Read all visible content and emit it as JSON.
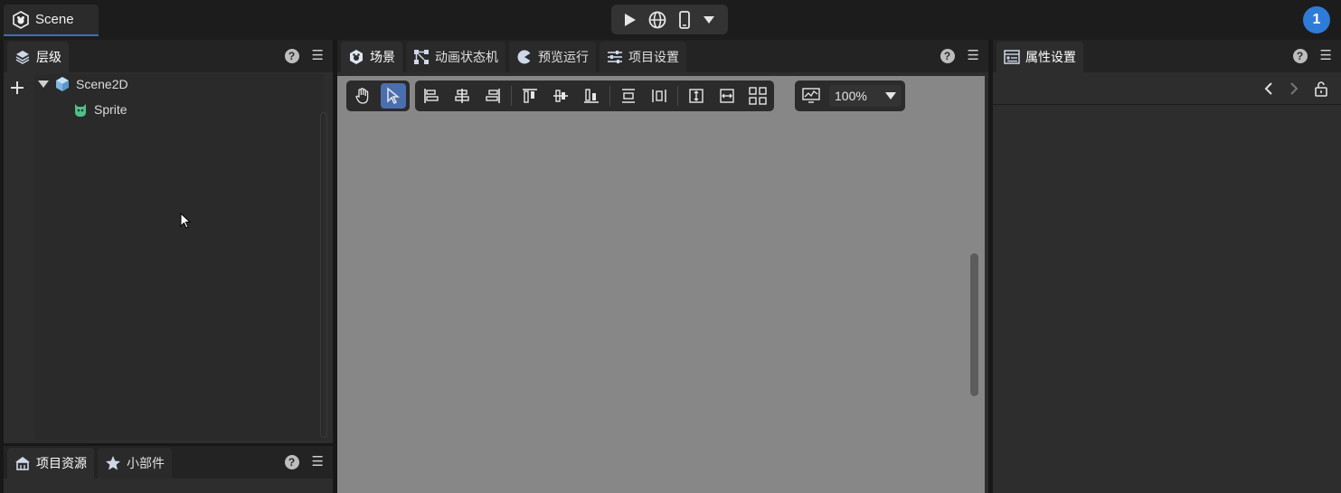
{
  "topbar": {
    "scene_tab_label": "Scene",
    "run_buttons": [
      "play-icon",
      "globe-icon",
      "phone-icon",
      "chevron-down-icon"
    ],
    "user_badge": "1"
  },
  "hierarchy": {
    "tab_label": "层级",
    "search_placeholder": "",
    "tree": [
      {
        "label": "Scene2D",
        "icon": "cube-icon",
        "expanded": true,
        "depth": 0
      },
      {
        "label": "Sprite",
        "icon": "sprite-icon",
        "depth": 1
      }
    ]
  },
  "assets": {
    "tabs": [
      {
        "label": "项目资源",
        "icon": "home-icon"
      },
      {
        "label": "小部件",
        "icon": "star-icon"
      }
    ]
  },
  "scene_panel": {
    "tabs": [
      {
        "label": "场景",
        "icon": "scene-icon"
      },
      {
        "label": "动画状态机",
        "icon": "state-machine-icon"
      },
      {
        "label": "预览运行",
        "icon": "preview-icon"
      },
      {
        "label": "项目设置",
        "icon": "sliders-icon"
      }
    ],
    "zoom_value": "100%"
  },
  "properties": {
    "tab_label": "属性设置"
  },
  "colors": {
    "accent": "#4a6fb0",
    "badge": "#2f7bd8",
    "viewport": "#878787"
  }
}
